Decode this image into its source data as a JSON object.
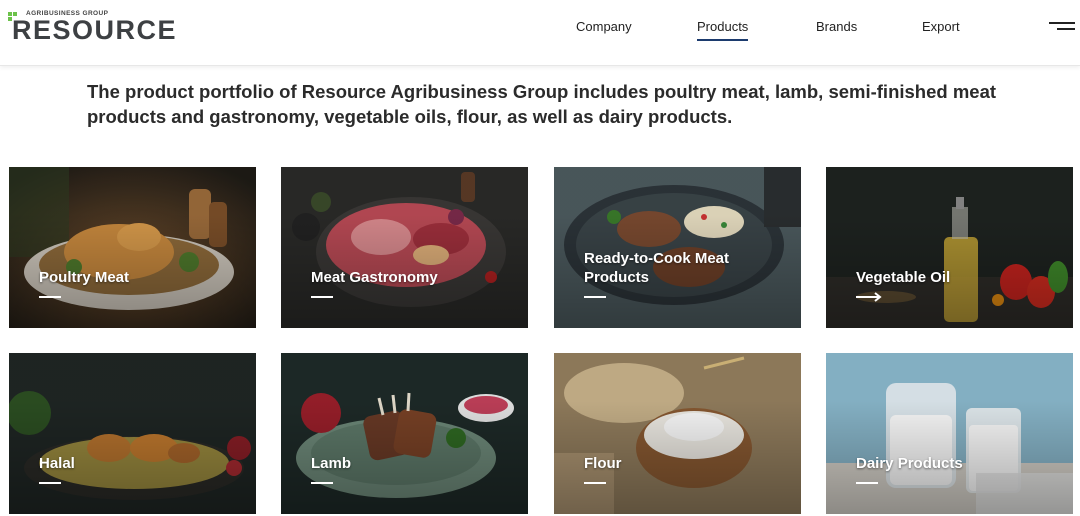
{
  "header": {
    "logo_sub": "AGRIBUSINESS GROUP",
    "logo_main": "RESOURCE",
    "nav": [
      {
        "label": "Company",
        "active": false
      },
      {
        "label": "Products",
        "active": true
      },
      {
        "label": "Brands",
        "active": false
      },
      {
        "label": "Export",
        "active": false
      }
    ],
    "menu_icon": "hamburger-icon"
  },
  "intro": {
    "text": "The product portfolio of Resource Agribusiness Group includes poultry meat, lamb, semi-finished meat products and gastronomy, vegetable oils, flour, as well as dairy products."
  },
  "products": [
    {
      "label": "Poultry Meat"
    },
    {
      "label": "Meat Gastronomy"
    },
    {
      "label": "Ready-to-Cook Meat Products"
    },
    {
      "label": "Vegetable Oil"
    },
    {
      "label": "Halal"
    },
    {
      "label": "Lamb"
    },
    {
      "label": "Flour"
    },
    {
      "label": "Dairy Products"
    }
  ],
  "colors": {
    "accent_green": "#6cc24a",
    "nav_underline": "#1c3b6e",
    "logo_text": "#3d4043"
  }
}
